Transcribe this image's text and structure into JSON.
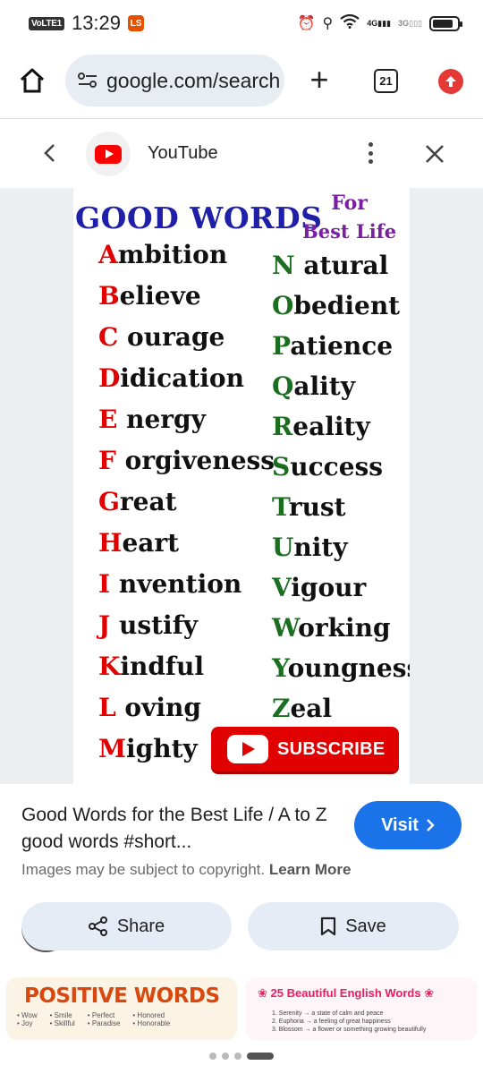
{
  "status_bar": {
    "volte": "VoLTE1",
    "time": "13:29",
    "badge": "LS",
    "net1": "4G",
    "net2": "3G",
    "battery_level": 0.85
  },
  "browser": {
    "url": "google.com/search",
    "tab_count": "21"
  },
  "sheet": {
    "source_name": "YouTube"
  },
  "poster": {
    "title": "GOOD WORDS",
    "subtitle_line1": "For",
    "subtitle_line2": "Best Life",
    "left_words": [
      {
        "letter": "A",
        "rest": "mbition"
      },
      {
        "letter": "B",
        "rest": "elieve"
      },
      {
        "letter": "C",
        "rest": " ourage"
      },
      {
        "letter": "D",
        "rest": "idication"
      },
      {
        "letter": "E",
        "rest": " nergy"
      },
      {
        "letter": "F",
        "rest": " orgiveness"
      },
      {
        "letter": "G",
        "rest": "reat"
      },
      {
        "letter": "H",
        "rest": "eart"
      },
      {
        "letter": "I",
        "rest": " nvention"
      },
      {
        "letter": "J",
        "rest": " ustify"
      },
      {
        "letter": "K",
        "rest": "indful"
      },
      {
        "letter": "L",
        "rest": " oving"
      },
      {
        "letter": "M",
        "rest": "ighty"
      }
    ],
    "right_words": [
      {
        "letter": "N",
        "rest": " atural"
      },
      {
        "letter": "O",
        "rest": "bedient"
      },
      {
        "letter": "P",
        "rest": "atience"
      },
      {
        "letter": "Q",
        "rest": "ality"
      },
      {
        "letter": "R",
        "rest": "eality"
      },
      {
        "letter": "S",
        "rest": "uccess"
      },
      {
        "letter": "T",
        "rest": "rust"
      },
      {
        "letter": "U",
        "rest": "nity"
      },
      {
        "letter": "V",
        "rest": "igour"
      },
      {
        "letter": "W",
        "rest": "orking"
      },
      {
        "letter": "Y",
        "rest": "oungness"
      },
      {
        "letter": "Z",
        "rest": "eal"
      }
    ],
    "subscribe_label": "SUBSCRIBE"
  },
  "result": {
    "title": "Good Words for the Best Life / A to Z good words #short...",
    "visit_label": "Visit",
    "copyright_text": "Images may be subject to copyright.",
    "learn_more": "Learn More",
    "share_label": "Share",
    "save_label": "Save"
  },
  "related": {
    "card1_title": "POSITIVE WORDS",
    "card1_words": [
      "Wow",
      "Smile",
      "Perfect",
      "Honored",
      "Joy",
      "Skillful",
      "Paradise",
      "Honorable"
    ],
    "card2_title": "25 Beautiful English Words",
    "card2_lines": [
      "1. Serenity → a state of calm and peace",
      "2. Euphoria → a feeling of great happiness",
      "3. Blossom → a flower or something growing beautifully"
    ]
  },
  "colors": {
    "accent_blue": "#1a73e8",
    "poster_red": "#e00000",
    "poster_green": "#1b6e20",
    "poster_title_blue": "#1f1fa8",
    "poster_sub_purple": "#7b1fa2"
  }
}
